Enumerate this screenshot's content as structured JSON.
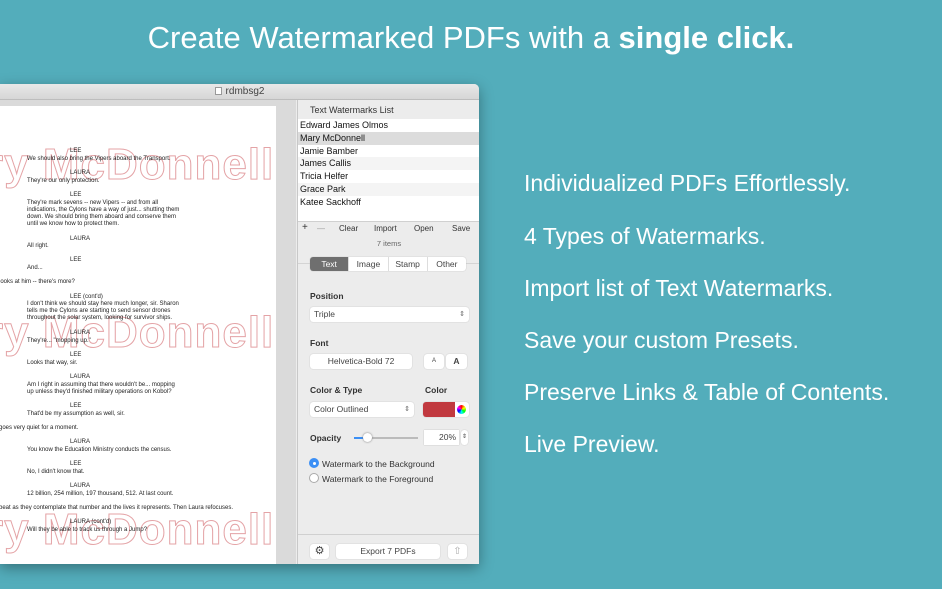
{
  "headline": {
    "regular": "Create Watermarked PDFs with a ",
    "bold": "single click."
  },
  "features": [
    "Individualized PDFs Effortlessly.",
    "4 Types of Watermarks.",
    "Import list of Text Watermarks.",
    "Save your custom Presets.",
    "Preserve Links & Table of Contents.",
    "Live Preview."
  ],
  "window": {
    "title": "rdmbsg2"
  },
  "document": {
    "watermark_text": "ry McDonnell",
    "lines": [
      {
        "t": "c",
        "s": "LEE"
      },
      {
        "t": "d",
        "s": "We should also bring the Vipers aboard the Transport."
      },
      {
        "t": "c",
        "s": "LAURA"
      },
      {
        "t": "d",
        "s": "They're our only protection."
      },
      {
        "t": "c",
        "s": "LEE"
      },
      {
        "t": "d",
        "s": "They're mark sevens -- new Vipers -- and from all"
      },
      {
        "t": "d",
        "s": "indications, the Cylons have a way of just... shutting them"
      },
      {
        "t": "d",
        "s": "down.  We should bring them aboard and conserve them"
      },
      {
        "t": "d",
        "s": "until we know how to protect them."
      },
      {
        "t": "c",
        "s": "LAURA"
      },
      {
        "t": "d",
        "s": "All right."
      },
      {
        "t": "c",
        "s": "LEE"
      },
      {
        "t": "d",
        "s": "And..."
      },
      {
        "t": "a",
        "s": "looks at him -- there's more?"
      },
      {
        "t": "c",
        "s": "LEE (cont'd)"
      },
      {
        "t": "d",
        "s": "I don't think we should stay here much longer, sir.  Sharon"
      },
      {
        "t": "d",
        "s": "tells me the Cylons are starting to send sensor drones"
      },
      {
        "t": "d",
        "s": "throughout the solar system, looking for survivor ships."
      },
      {
        "t": "c",
        "s": "LAURA"
      },
      {
        "t": "d",
        "s": "They're... \"mopping up.\""
      },
      {
        "t": "c",
        "s": "LEE"
      },
      {
        "t": "d",
        "s": "Looks that way, sir."
      },
      {
        "t": "c",
        "s": "LAURA"
      },
      {
        "t": "d",
        "s": "Am I right in assuming that there wouldn't be... mopping"
      },
      {
        "t": "d",
        "s": "up unless they'd finished military operations on Kobol?"
      },
      {
        "t": "c",
        "s": "LEE"
      },
      {
        "t": "d",
        "s": "That'd be my assumption as well, sir."
      },
      {
        "t": "a",
        "s": "goes very quiet for a moment."
      },
      {
        "t": "c",
        "s": "LAURA"
      },
      {
        "t": "d",
        "s": "You know the Education Ministry conducts the census."
      },
      {
        "t": "c",
        "s": "LEE"
      },
      {
        "t": "d",
        "s": "No, I didn't know that."
      },
      {
        "t": "c",
        "s": "LAURA"
      },
      {
        "t": "d",
        "s": "12 billion, 254 million, 197 thousand, 512.  At last count."
      },
      {
        "t": "a",
        "s": " beat as they contemplate that number and the lives it represents.  Then Laura refocuses."
      },
      {
        "t": "c",
        "s": "LAURA (cont'd)"
      },
      {
        "t": "d",
        "s": "Will they be able to track us through a Jump?"
      }
    ]
  },
  "sidebar": {
    "list_title": "Text Watermarks List",
    "items": [
      "Edward James Olmos",
      "Mary McDonnell",
      "Jamie Bamber",
      "James Callis",
      "Tricia Helfer",
      "Grace Park",
      "Katee Sackhoff"
    ],
    "selected_index": 1,
    "list_buttons": {
      "add": "+",
      "remove": "—",
      "clear": "Clear",
      "import": "Import",
      "open": "Open",
      "save": "Save"
    },
    "count": "7 items",
    "tabs": [
      "Text",
      "Image",
      "Stamp",
      "Other"
    ],
    "active_tab": "Text",
    "position_label": "Position",
    "position_value": "Triple",
    "font_label": "Font",
    "font_value": "Helvetica-Bold 72",
    "font_smaller": "A",
    "font_larger": "A",
    "color_type_label": "Color & Type",
    "color_type_value": "Color Outlined",
    "color_label": "Color",
    "color_value": "#c1393f",
    "opacity_label": "Opacity",
    "opacity_value": "20%",
    "opacity_fraction": 0.2,
    "radio_background": "Watermark to the Background",
    "radio_foreground": "Watermark to the Foreground",
    "radio_selected": "background",
    "export_label": "Export 7 PDFs"
  }
}
